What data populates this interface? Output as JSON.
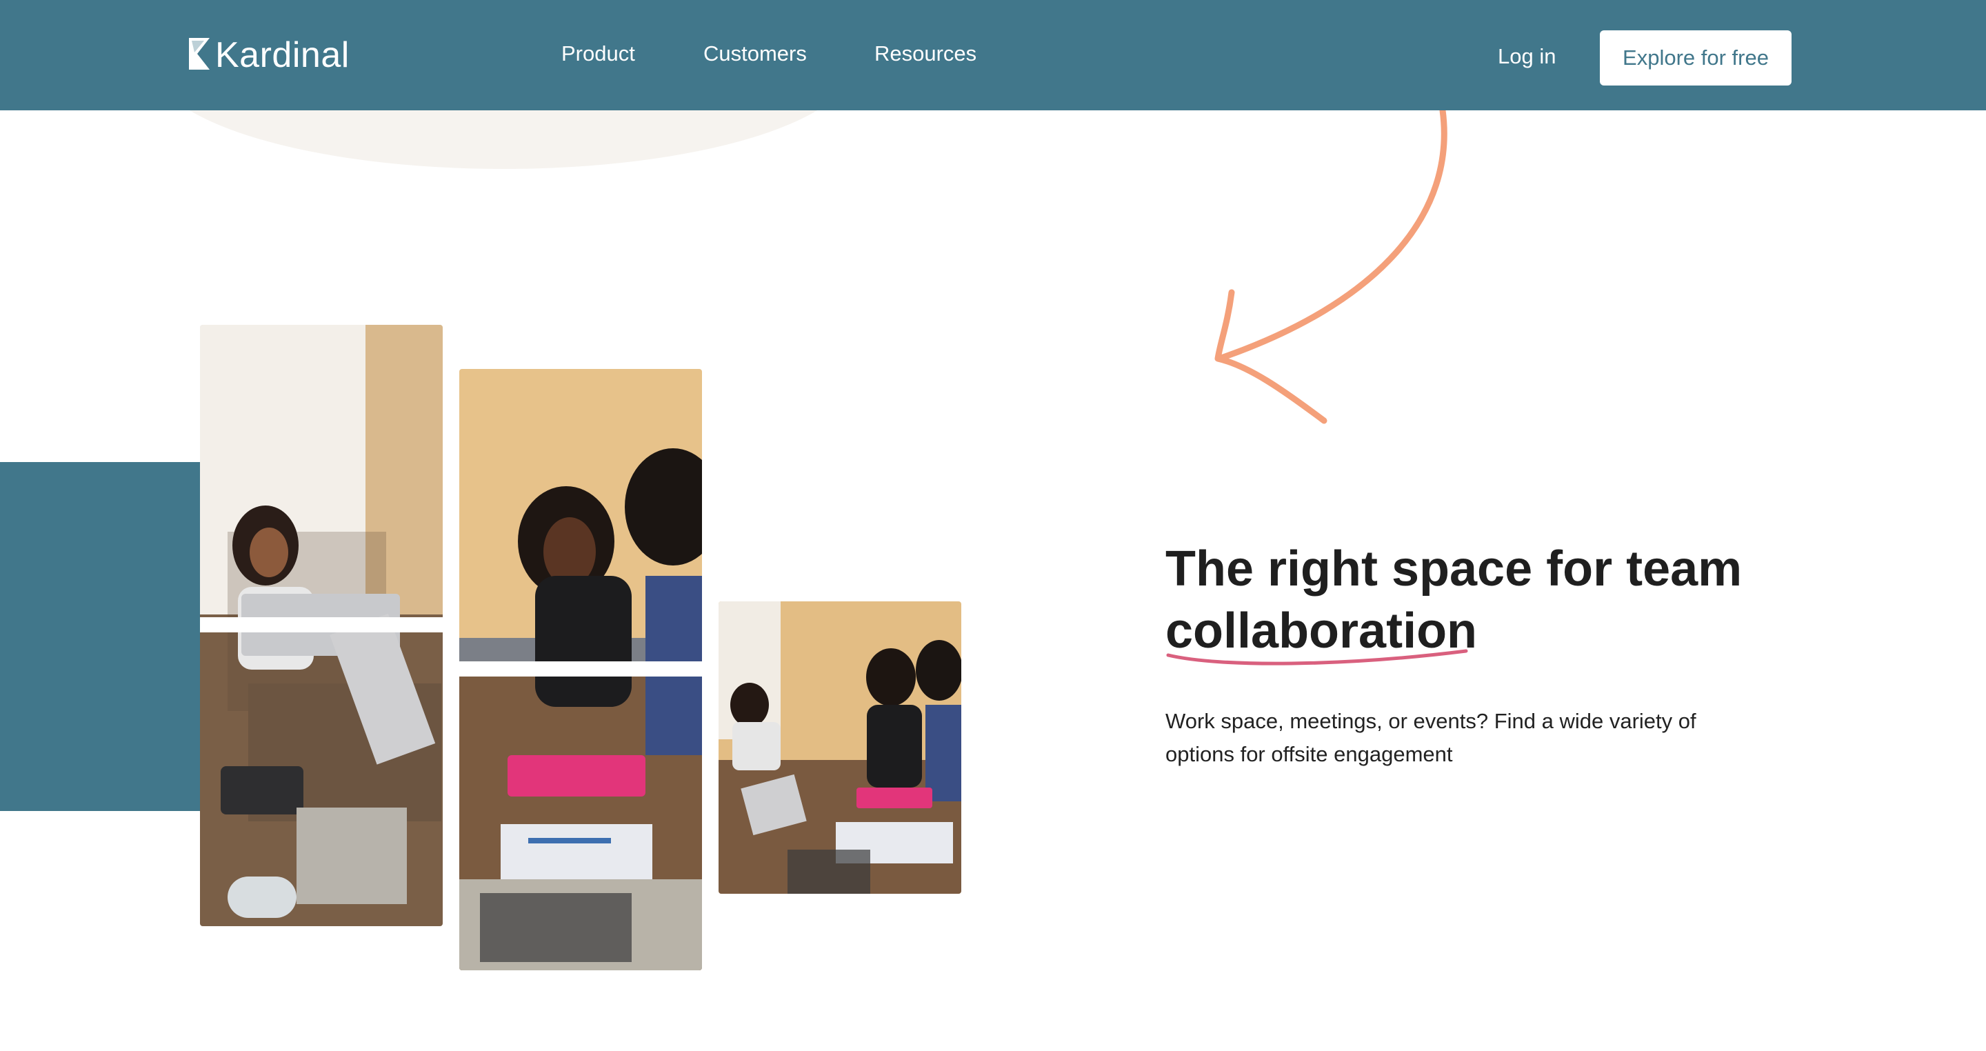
{
  "header": {
    "logo_text": "Kardinal",
    "nav": {
      "product": "Product",
      "customers": "Customers",
      "resources": "Resources"
    },
    "login_label": "Log in",
    "cta_label": "Explore for free"
  },
  "hero": {
    "headline_line1": "The right space for team",
    "headline_line2": "collaboration",
    "subtext": "Work space, meetings, or events? Find a wide variety of options for offsite engagement"
  },
  "colors": {
    "brand_teal": "#41778b",
    "arrow_salmon": "#f4a07a",
    "underline_pink": "#d9607e",
    "beige": "#f6f3ef"
  },
  "icons": {
    "logo": "kardinal-logo-icon",
    "arrow": "curved-arrow-icon",
    "underline": "underline-swash-icon"
  }
}
